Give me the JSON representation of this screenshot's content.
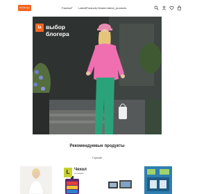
{
  "header": {
    "logo_label": "Brand logo",
    "nav": {
      "fashion": "Fashion",
      "path": "LatestProducts:Header:latest_products"
    },
    "icons": [
      "search-icon",
      "user-icon",
      "heart-icon",
      "bag-icon"
    ]
  },
  "hero": {
    "badge": "la",
    "title_line1": "выбор",
    "title_line2": "блогера"
  },
  "products": {
    "title": "Рекомендуемые продукты",
    "subtitle": "Горячий",
    "cards": [
      {
        "name": "",
        "badge": ""
      },
      {
        "name": "Чехол",
        "sub": "на чемодан",
        "badge": "L"
      },
      {
        "name": "",
        "badge": ""
      },
      {
        "name": "",
        "badge": ""
      }
    ]
  },
  "colors": {
    "accent": "#f26522",
    "hero_bg": "#2f3331",
    "badge_green": "#c7d22f"
  }
}
